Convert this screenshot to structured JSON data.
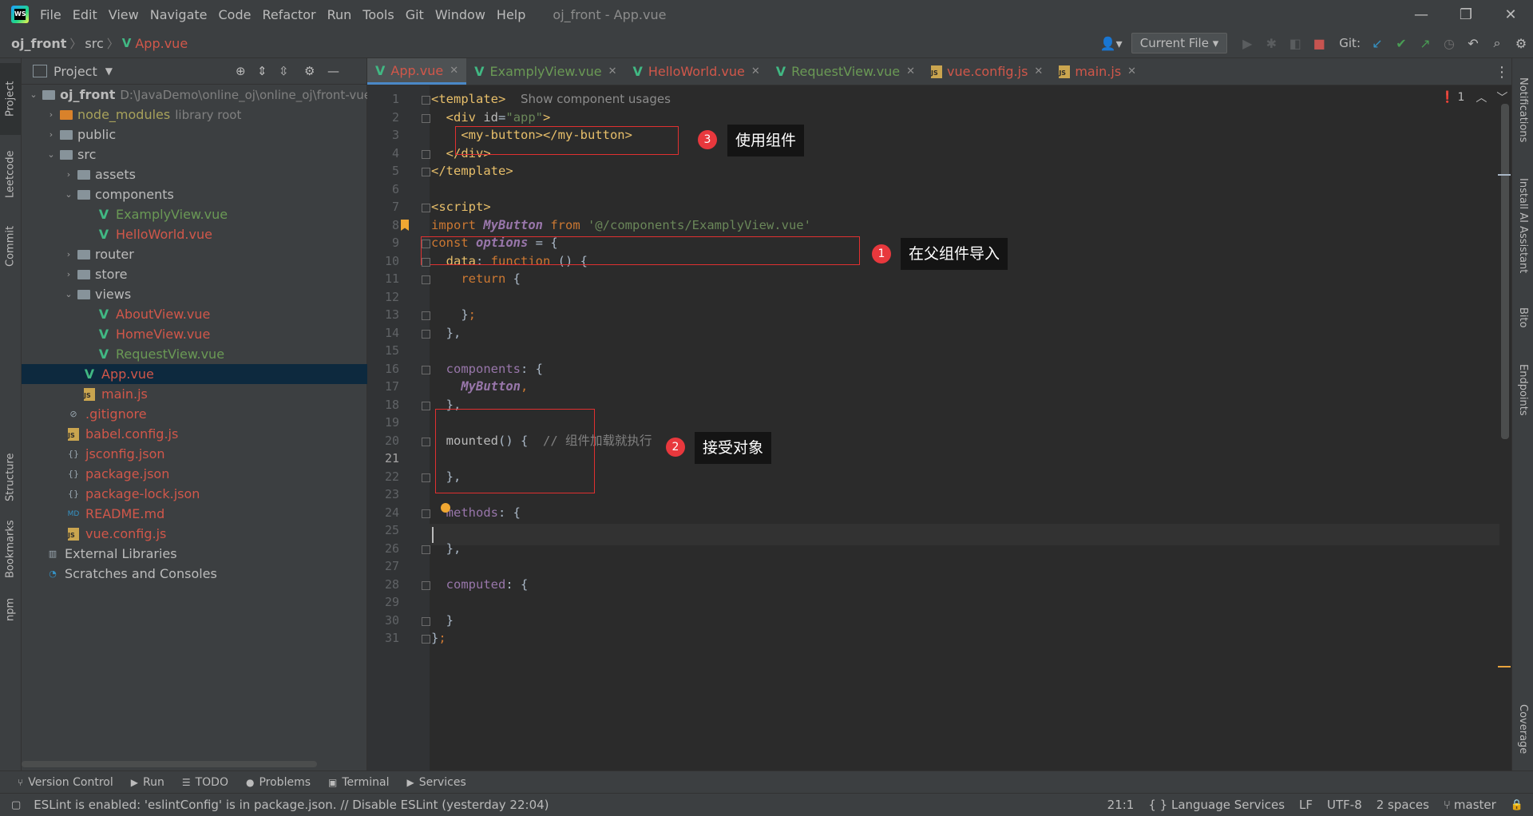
{
  "titlebar": {
    "logo": "WS",
    "menu": [
      "File",
      "Edit",
      "View",
      "Navigate",
      "Code",
      "Refactor",
      "Run",
      "Tools",
      "Git",
      "Window",
      "Help"
    ],
    "window_title": "oj_front - App.vue",
    "controls": {
      "minimize": "—",
      "maximize": "❐",
      "close": "✕"
    }
  },
  "navbar": {
    "breadcrumb": [
      "oj_front",
      "src",
      "App.vue"
    ],
    "run_config": "Current File",
    "git_label": "Git:"
  },
  "left_stripe": [
    "Project",
    "Leetcode",
    "Commit",
    "Structure",
    "Bookmarks",
    "npm"
  ],
  "right_stripe": [
    "Notifications",
    "Install AI Assistant",
    "Bito",
    "Endpoints",
    "Coverage"
  ],
  "project": {
    "title": "Project",
    "tree": [
      {
        "label": "oj_front",
        "hint": "D:\\JavaDemo\\online_oj\\online_oj\\front-vue",
        "kind": "folder",
        "bold": true,
        "arrow": "⌄"
      },
      {
        "label": "node_modules",
        "hint": "library root",
        "kind": "folder-orange",
        "color": "#a7a15b",
        "arrow": "›"
      },
      {
        "label": "public",
        "kind": "folder",
        "arrow": "›"
      },
      {
        "label": "src",
        "kind": "folder",
        "arrow": "⌄"
      },
      {
        "label": "assets",
        "kind": "folder",
        "arrow": "›"
      },
      {
        "label": "components",
        "kind": "folder",
        "arrow": "⌄"
      },
      {
        "label": "ExamplyView.vue",
        "kind": "vue",
        "color": "#6a9955"
      },
      {
        "label": "HelloWorld.vue",
        "kind": "vue",
        "color": "#d1574a"
      },
      {
        "label": "router",
        "kind": "folder",
        "arrow": "›"
      },
      {
        "label": "store",
        "kind": "folder",
        "arrow": "›"
      },
      {
        "label": "views",
        "kind": "folder",
        "arrow": "⌄"
      },
      {
        "label": "AboutView.vue",
        "kind": "vue",
        "color": "#d1574a"
      },
      {
        "label": "HomeView.vue",
        "kind": "vue",
        "color": "#d1574a"
      },
      {
        "label": "RequestView.vue",
        "kind": "vue",
        "color": "#6a9955"
      },
      {
        "label": "App.vue",
        "kind": "vue",
        "color": "#d1574a",
        "selected": true
      },
      {
        "label": "main.js",
        "kind": "js",
        "color": "#d1574a"
      },
      {
        "label": ".gitignore",
        "kind": "file",
        "color": "#d1574a"
      },
      {
        "label": "babel.config.js",
        "kind": "js",
        "color": "#d1574a"
      },
      {
        "label": "jsconfig.json",
        "kind": "json",
        "color": "#d1574a"
      },
      {
        "label": "package.json",
        "kind": "json",
        "color": "#d1574a"
      },
      {
        "label": "package-lock.json",
        "kind": "json",
        "color": "#d1574a"
      },
      {
        "label": "README.md",
        "kind": "md",
        "color": "#d1574a"
      },
      {
        "label": "vue.config.js",
        "kind": "js",
        "color": "#d1574a"
      },
      {
        "label": "External Libraries",
        "kind": "lib"
      },
      {
        "label": "Scratches and Consoles",
        "kind": "scratch"
      }
    ]
  },
  "tabs": [
    {
      "label": "App.vue",
      "kind": "vue",
      "color": "#d1574a",
      "active": true
    },
    {
      "label": "ExamplyView.vue",
      "kind": "vue",
      "color": "#6a9955"
    },
    {
      "label": "HelloWorld.vue",
      "kind": "vue",
      "color": "#d1574a"
    },
    {
      "label": "RequestView.vue",
      "kind": "vue",
      "color": "#6a9955"
    },
    {
      "label": "vue.config.js",
      "kind": "js",
      "color": "#d1574a"
    },
    {
      "label": "main.js",
      "kind": "js",
      "color": "#d1574a"
    }
  ],
  "editor": {
    "error_count": "1",
    "current_line": 21,
    "lines": [
      "<span class=\"t\">&lt;template&gt;</span>  <span class=\"hintg\">Show component usages</span>",
      "  <span class=\"t\">&lt;div </span><span class=\"a\">id</span>=<span class=\"s\">\"app\"</span><span class=\"t\">&gt;</span>",
      "    <span class=\"t\">&lt;my-button&gt;&lt;/my-button&gt;</span>",
      "  <span class=\"t\">&lt;/div&gt;</span>",
      "<span class=\"t\">&lt;/template&gt;</span>",
      "",
      "<span class=\"t\">&lt;script&gt;</span>",
      "<span class=\"k\">import</span> <span class=\"f\">MyButton</span> <span class=\"k\">from</span> <span class=\"s\">'@/components/ExamplyView.vue'</span>",
      "<span class=\"k\">const</span> <span class=\"f\">options</span> = {",
      "  <span class=\"t\">data</span>: <span class=\"k\">function</span> () {",
      "    <span class=\"k\">return</span> {",
      "",
      "    }<span class=\"k\">;</span>",
      "  },",
      "",
      "  <span class=\"p\">components</span>: {",
      "    <span class=\"f\">MyButton</span><span class=\"k\">,</span>",
      "  },",
      "",
      "  <span class=\"a\">mounted</span>() {  <span class=\"c\">// 组件加载就执行</span>",
      "",
      "  },",
      "",
      "  <span class=\"p\">methods</span>: {",
      "",
      "  },",
      "",
      "  <span class=\"p\">computed</span>: {",
      "",
      "  }",
      "}<span class=\"k\">;</span>"
    ]
  },
  "annotations": [
    {
      "num": "1",
      "text": "在父组件导入"
    },
    {
      "num": "2",
      "text": "接受对象"
    },
    {
      "num": "3",
      "text": "使用组件"
    }
  ],
  "bottom_tabs": [
    {
      "icon": "⑂",
      "label": "Version Control"
    },
    {
      "icon": "▶",
      "label": "Run"
    },
    {
      "icon": "☰",
      "label": "TODO"
    },
    {
      "icon": "●",
      "label": "Problems"
    },
    {
      "icon": "▣",
      "label": "Terminal"
    },
    {
      "icon": "▶",
      "label": "Services"
    }
  ],
  "status": {
    "message": "ESLint is enabled: 'eslintConfig' is in package.json. // Disable ESLint (yesterday 22:04)",
    "position": "21:1",
    "language_services": "{ } Language Services",
    "line_sep": "LF",
    "encoding": "UTF-8",
    "indent": "2 spaces",
    "branch": "master"
  }
}
